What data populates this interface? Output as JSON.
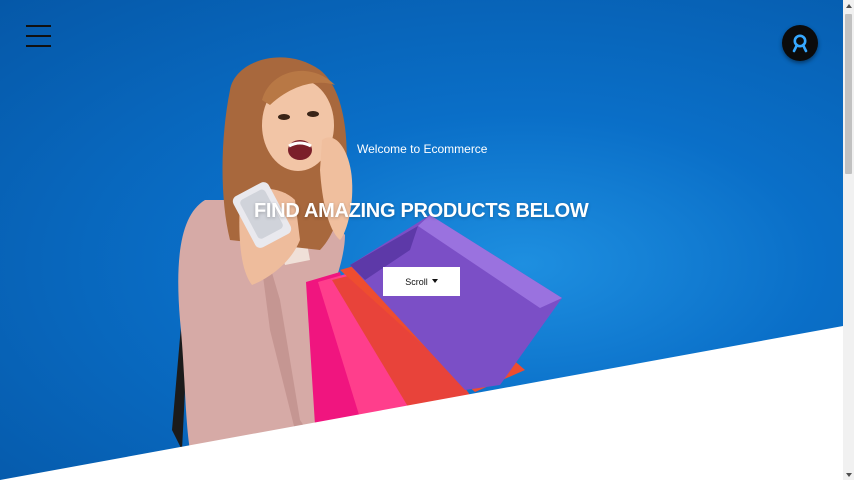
{
  "hero": {
    "welcome_text": "Welcome to Ecommerce",
    "headline": "FIND AMAZING PRODUCTS BELOW",
    "scroll_button_label": "Scroll"
  },
  "icons": {
    "menu": "hamburger-menu-icon",
    "account": "user-avatar-icon",
    "scroll_caret": "caret-down-icon"
  },
  "colors": {
    "hero_blue": "#0a6fc8",
    "white": "#ffffff",
    "button_text": "#111111",
    "bag_purple": "#7b4fc6",
    "bag_pink": "#f0157f",
    "bag_red": "#e8433a",
    "coat_pink": "#d9aeaa"
  }
}
